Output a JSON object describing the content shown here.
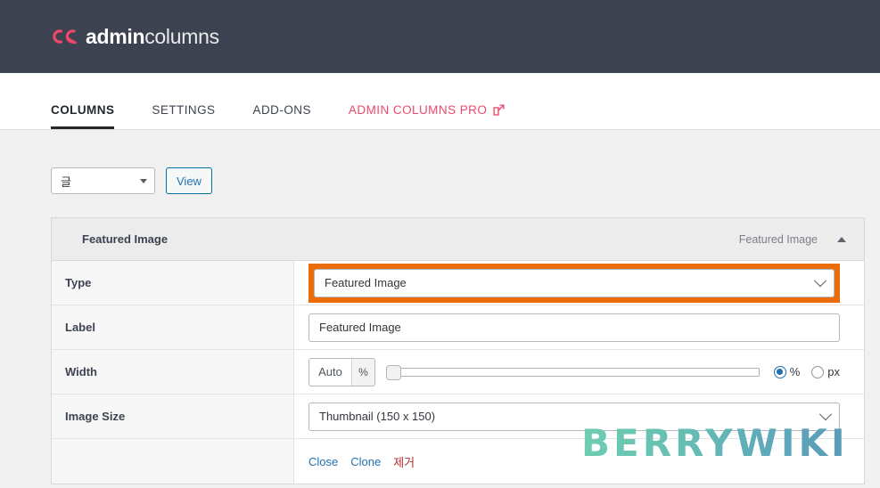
{
  "header": {
    "logo_icon": "admin-columns-logo-icon",
    "brand_bold": "admin",
    "brand_light": "columns"
  },
  "nav": {
    "items": [
      {
        "label": "COLUMNS",
        "active": true
      },
      {
        "label": "SETTINGS",
        "active": false
      },
      {
        "label": "ADD-ONS",
        "active": false
      },
      {
        "label": "ADMIN COLUMNS PRO",
        "active": false,
        "external": true,
        "icon": "external-link-icon"
      }
    ]
  },
  "toolbar": {
    "post_type_select_value": "글",
    "post_type_select_icon": "chevron-down-icon",
    "view_button_label": "View"
  },
  "panel": {
    "title": "Featured Image",
    "subtitle": "Featured Image",
    "toggle_icon": "chevron-up-icon",
    "rows": {
      "type": {
        "label": "Type",
        "value": "Featured Image",
        "icon": "chevron-down-icon",
        "highlight_color": "#ea6c0b",
        "highlighted": true
      },
      "label": {
        "label": "Label",
        "value": "Featured Image",
        "placeholder": "Label"
      },
      "width": {
        "label": "Width",
        "input_value": "Auto",
        "input_placeholder": "Auto",
        "unit_suffix": "%",
        "slider_value": 0,
        "slider_min": 0,
        "slider_max": 100,
        "units": [
          {
            "label": "%",
            "selected": true
          },
          {
            "label": "px",
            "selected": false
          }
        ]
      },
      "image_size": {
        "label": "Image Size",
        "value": "Thumbnail (150 x 150)",
        "icon": "chevron-down-icon"
      }
    },
    "actions": {
      "close_label": "Close",
      "clone_label": "Clone",
      "remove_label": "제거"
    }
  },
  "watermark": {
    "text": "BERRYWIKI"
  },
  "colors": {
    "header_bg": "#3c4250",
    "brand_pink": "#f0486a",
    "link_blue": "#2271b1",
    "remove_red": "#b32d2e",
    "highlight_orange": "#ea6c0b",
    "page_bg": "#f1f1f1"
  }
}
